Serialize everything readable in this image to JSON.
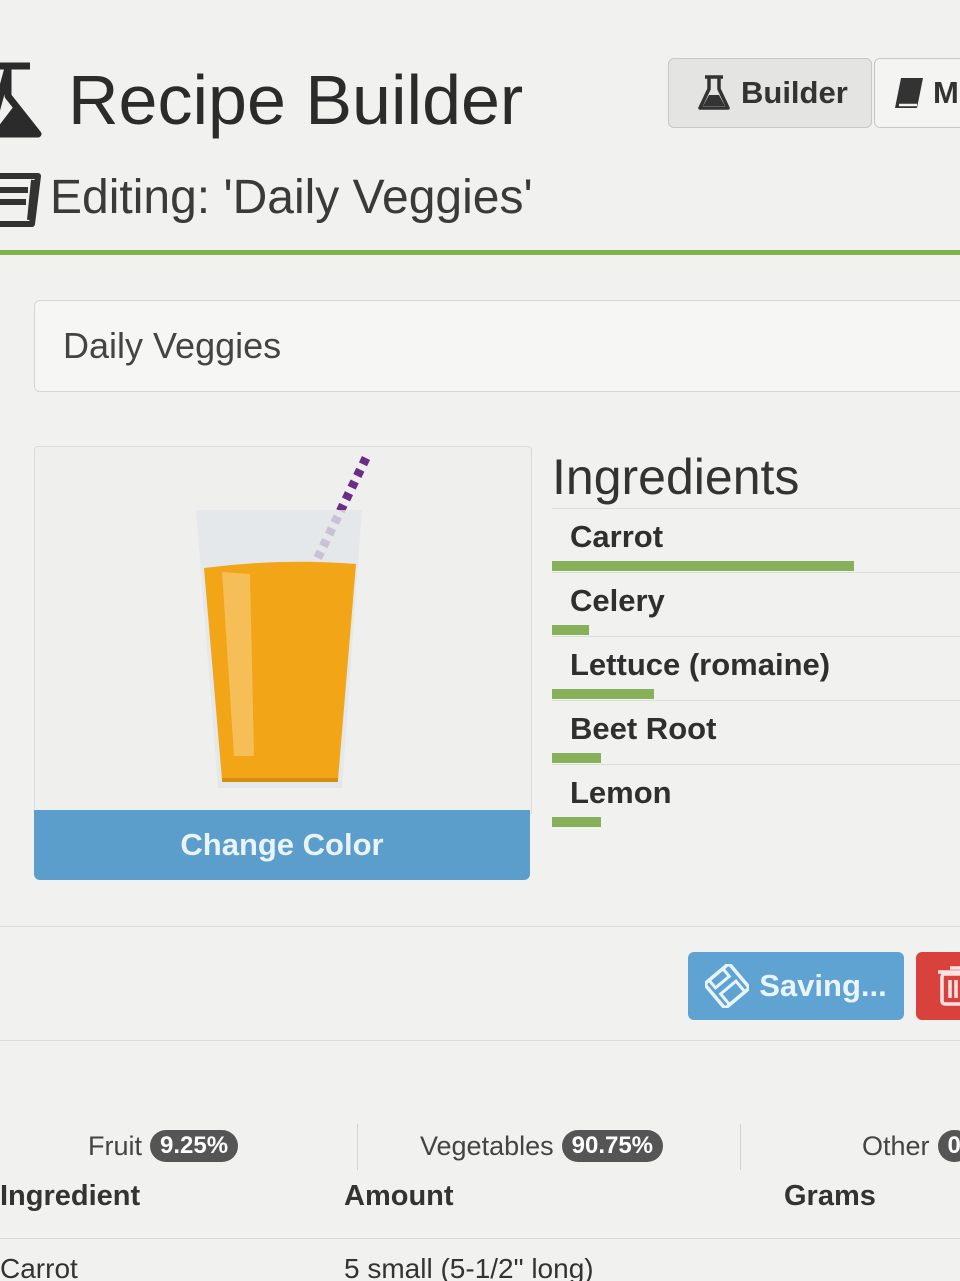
{
  "header": {
    "app_title": "Recipe Builder",
    "nav": [
      {
        "label": "Builder",
        "icon": "flask-icon",
        "active": true
      },
      {
        "label": "M",
        "icon": "book-icon",
        "active": false
      }
    ]
  },
  "editing": {
    "title": "Editing: 'Daily Veggies'",
    "icon": "book-icon"
  },
  "recipe_name": {
    "value": "Daily Veggies"
  },
  "preview": {
    "juice_color": "#f2a516",
    "straw_color": "#6b2d86",
    "change_color_label": "Change Color"
  },
  "ingredients": {
    "heading": "Ingredients",
    "items": [
      {
        "name": "Carrot",
        "share": 0.74
      },
      {
        "name": "Celery",
        "share": 0.09
      },
      {
        "name": "Lettuce (romaine)",
        "share": 0.25
      },
      {
        "name": "Beet Root",
        "share": 0.12
      },
      {
        "name": "Lemon",
        "share": 0.12
      }
    ],
    "bar_color": "#86b15a"
  },
  "actions": {
    "saving_label": "Saving...",
    "save_icon": "floppy-icon",
    "delete_icon": "trash-icon"
  },
  "categories": [
    {
      "label": "Fruit",
      "percent": "9.25%"
    },
    {
      "label": "Vegetables",
      "percent": "90.75%"
    },
    {
      "label": "Other",
      "percent": "0"
    }
  ],
  "table": {
    "columns": [
      "Ingredient",
      "Amount",
      "Grams"
    ],
    "rows": [
      {
        "ingredient": "Carrot",
        "amount": "5 small (5-1/2\" long)"
      }
    ]
  },
  "colors": {
    "accent_green": "#7fb24a",
    "button_blue": "#5b9ecb",
    "danger_red": "#d9413c"
  }
}
